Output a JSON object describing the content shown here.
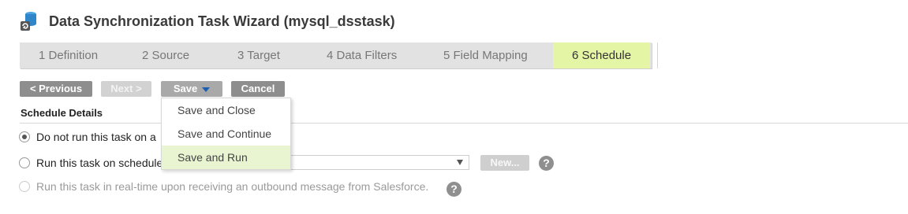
{
  "header": {
    "title": "Data Synchronization Task Wizard (mysql_dsstask)"
  },
  "steps": [
    {
      "label": "1  Definition",
      "active": false
    },
    {
      "label": "2  Source",
      "active": false
    },
    {
      "label": "3  Target",
      "active": false
    },
    {
      "label": "4  Data Filters",
      "active": false
    },
    {
      "label": "5  Field Mapping",
      "active": false
    },
    {
      "label": "6  Schedule",
      "active": true
    }
  ],
  "toolbar": {
    "previous": "< Previous",
    "next": "Next >",
    "save": "Save",
    "cancel": "Cancel"
  },
  "save_menu": [
    "Save and Close",
    "Save and Continue",
    "Save and Run"
  ],
  "schedule": {
    "section_title": "Schedule Details",
    "option_no_schedule": "Do not run this task on a",
    "option_on_schedule": "Run this task on schedule",
    "option_realtime": "Run this task in real-time upon receiving an outbound message from Salesforce.",
    "new_button": "New...",
    "help": "?"
  },
  "colors": {
    "active_step": "#e5f5a6",
    "menu_hover": "#e8f5d0",
    "caret": "#1a5fb4"
  }
}
